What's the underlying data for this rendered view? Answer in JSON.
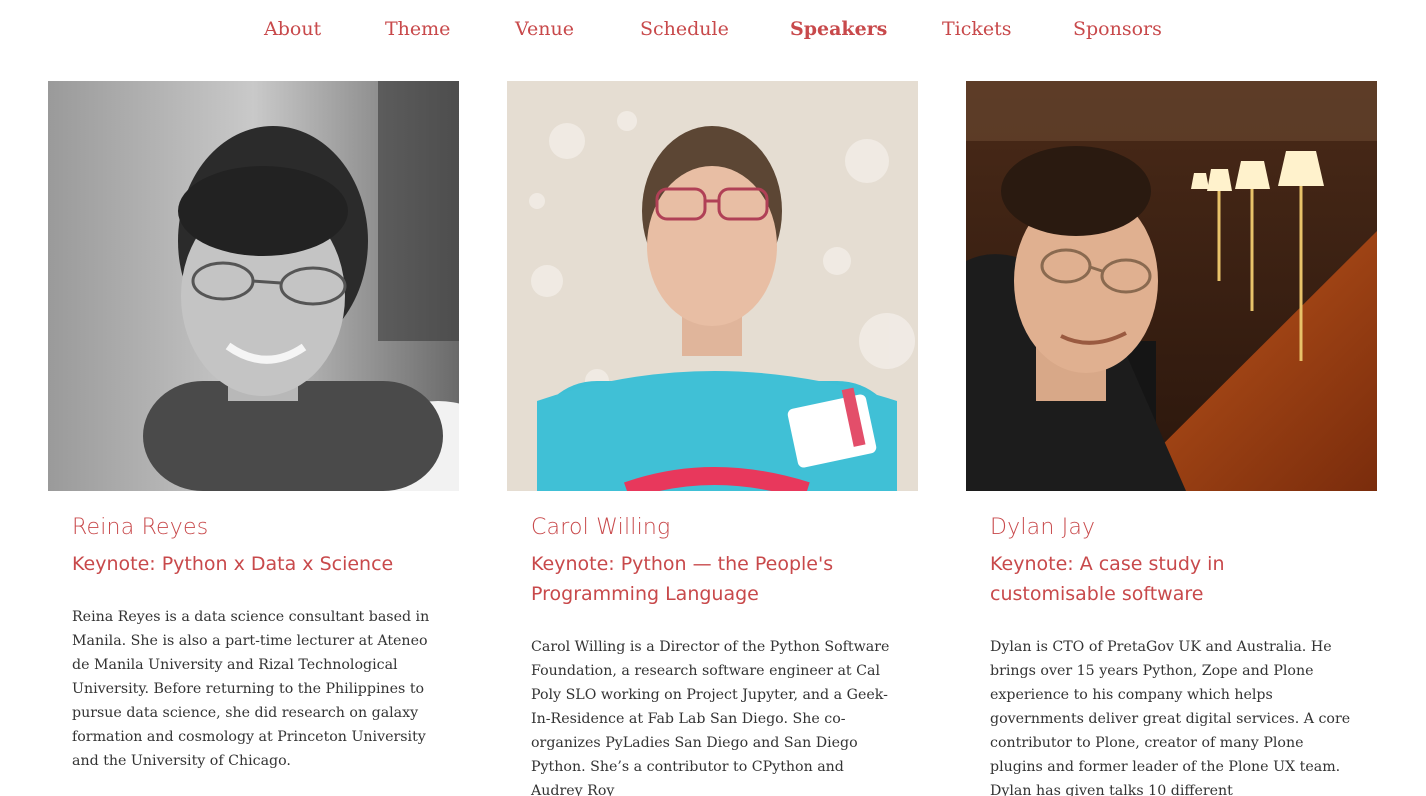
{
  "nav": {
    "items": [
      "About",
      "Theme",
      "Venue",
      "Schedule",
      "Speakers",
      "Tickets",
      "Sponsors"
    ],
    "active": "Speakers"
  },
  "colors": {
    "accent": "#c8494b",
    "text": "#333333",
    "background": "#ffffff"
  },
  "speakers": [
    {
      "name": "Reina Reyes",
      "talk": "Keynote: Python x Data x Science",
      "bio": "Reina Reyes is a data science consultant based in Manila. She is also a part-time lecturer at Ateneo de Manila University and Rizal Technological University. Before returning to the Philippines to pursue data science, she did research on galaxy formation and cosmology at Princeton University and the University of Chicago.",
      "photo_icon": "speaker-photo-grayscale"
    },
    {
      "name": "Carol Willing",
      "talk": "Keynote: Python — the People's Programming Language",
      "bio": "Carol Willing is a Director of the Python Software Foundation, a research software engineer at Cal Poly SLO working on Project Jupyter, and a Geek-In-Residence at Fab Lab San Diego. She co-organizes PyLadies San Diego and San Diego Python. She’s a contributor to CPython and Audrey Roy",
      "photo_icon": "speaker-photo-pyladies-shirt"
    },
    {
      "name": "Dylan Jay",
      "talk": "Keynote: A case study in customisable software",
      "bio": "Dylan is CTO of PretaGov UK and Australia. He brings over 15 years Python, Zope and Plone experience to his company which helps governments deliver great digital services. A core contributor to Plone, creator of many Plone plugins and former leader of the Plone UX team. Dylan has given talks 10 different",
      "photo_icon": "speaker-photo-library"
    }
  ]
}
